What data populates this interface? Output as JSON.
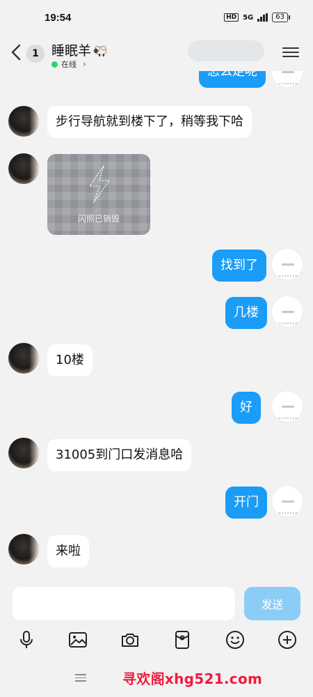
{
  "status_bar": {
    "time": "19:54",
    "hd": "HD",
    "network": "5G",
    "battery": "63"
  },
  "header": {
    "unread_count": "1",
    "contact_name": "睡眠羊",
    "presence": "在线",
    "presence_color": "#2bd66a"
  },
  "messages": [
    {
      "side": "out",
      "text": "怎么走呢"
    },
    {
      "side": "in",
      "text": "步行导航就到楼下了，稍等我下哈"
    },
    {
      "side": "in",
      "type": "flash_photo",
      "label": "闪照已销毁"
    },
    {
      "side": "out",
      "text": "找到了"
    },
    {
      "side": "out",
      "text": "几楼"
    },
    {
      "side": "in",
      "text": "10楼"
    },
    {
      "side": "out",
      "text": "好"
    },
    {
      "side": "in",
      "text": "31005到门口发消息哈"
    },
    {
      "side": "out",
      "text": "开门"
    },
    {
      "side": "in",
      "text": "来啦"
    }
  ],
  "composer": {
    "input_value": "",
    "send_label": "发送",
    "tools": [
      "microphone-icon",
      "image-icon",
      "camera-icon",
      "red-packet-icon",
      "emoji-icon",
      "plus-icon"
    ]
  },
  "colors": {
    "outgoing_bubble": "#1a9cf7",
    "send_button": "#8ccdf7",
    "background": "#f2f2f2"
  },
  "watermark": "寻欢阁xhg521.com"
}
